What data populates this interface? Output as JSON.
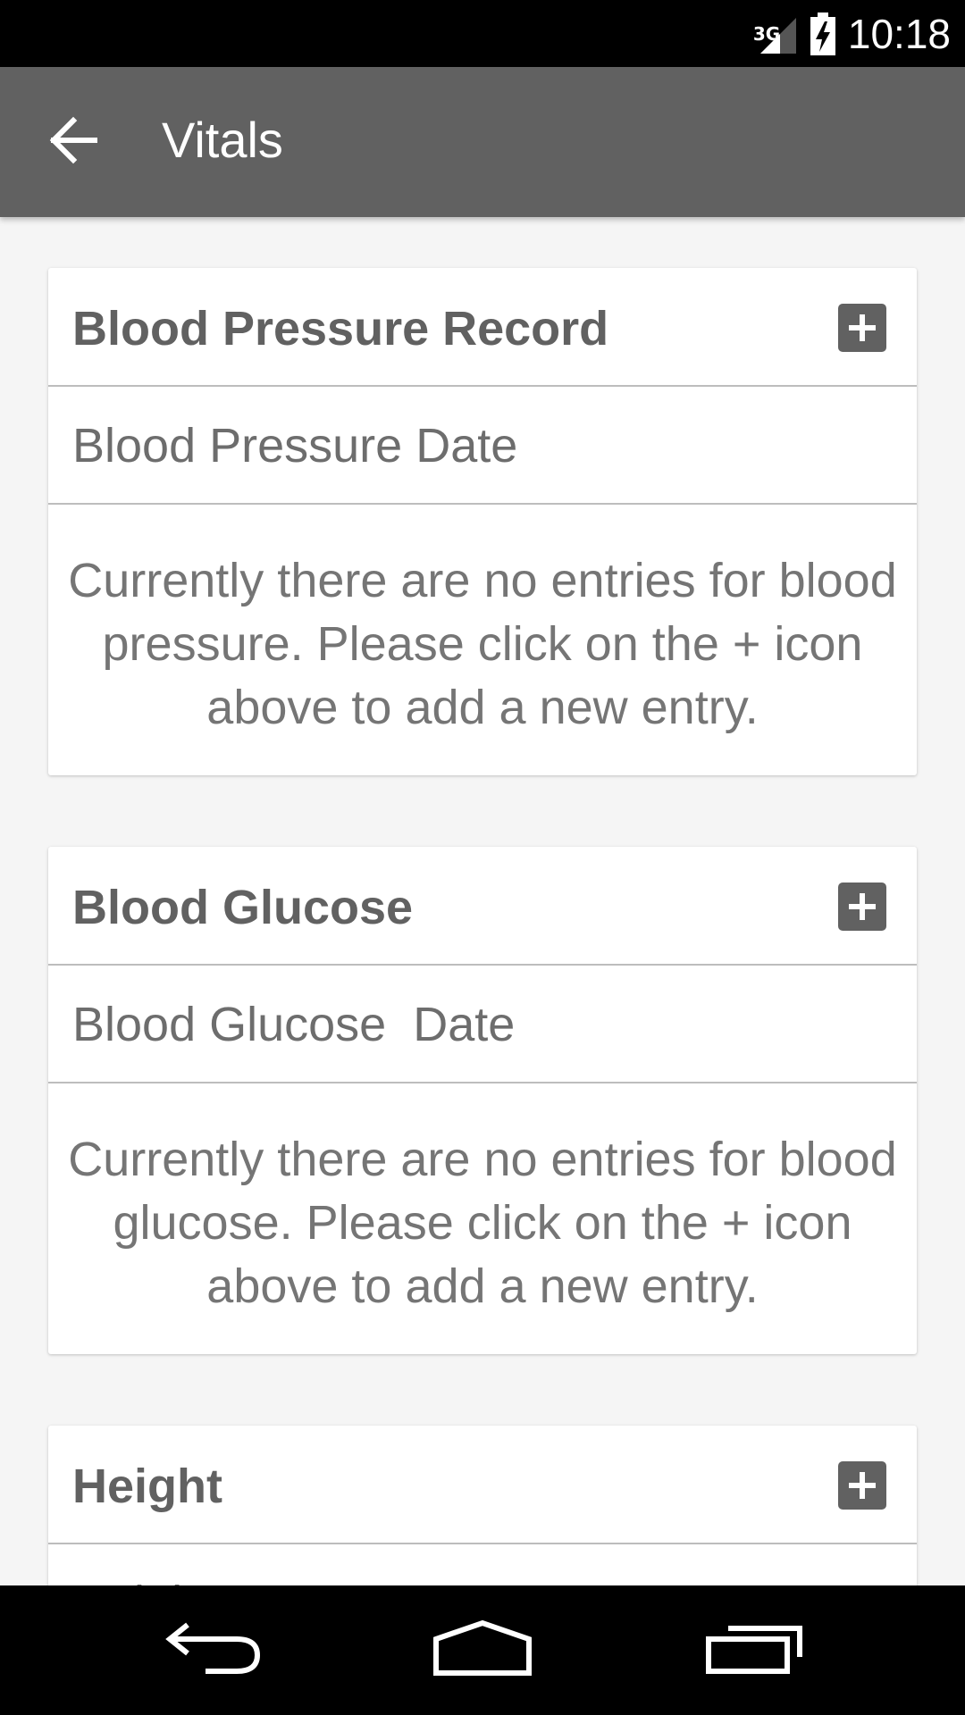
{
  "status_bar": {
    "network": "3G",
    "time": "10:18"
  },
  "app_bar": {
    "title": "Vitals",
    "back_icon": "arrow-back-icon"
  },
  "cards": [
    {
      "title": "Blood Pressure Record",
      "add_icon": "plus-box-icon",
      "subhead": "Blood Pressure Date",
      "empty_message": "Currently there are no entries for blood pressure. Please click on the + icon above to add a new entry."
    },
    {
      "title": "Blood Glucose",
      "add_icon": "plus-box-icon",
      "subhead": "Blood Glucose  Date",
      "empty_message": "Currently there are no entries for blood glucose. Please click on the + icon above to add a new entry."
    },
    {
      "title": "Height",
      "add_icon": "plus-box-icon",
      "subhead": "Height              Date"
    }
  ],
  "nav_bar": {
    "back_icon": "nav-back-icon",
    "home_icon": "nav-home-icon",
    "recents_icon": "nav-recents-icon"
  },
  "colors": {
    "app_bar": "#616161",
    "background": "#f5f5f5",
    "text": "#757575"
  }
}
